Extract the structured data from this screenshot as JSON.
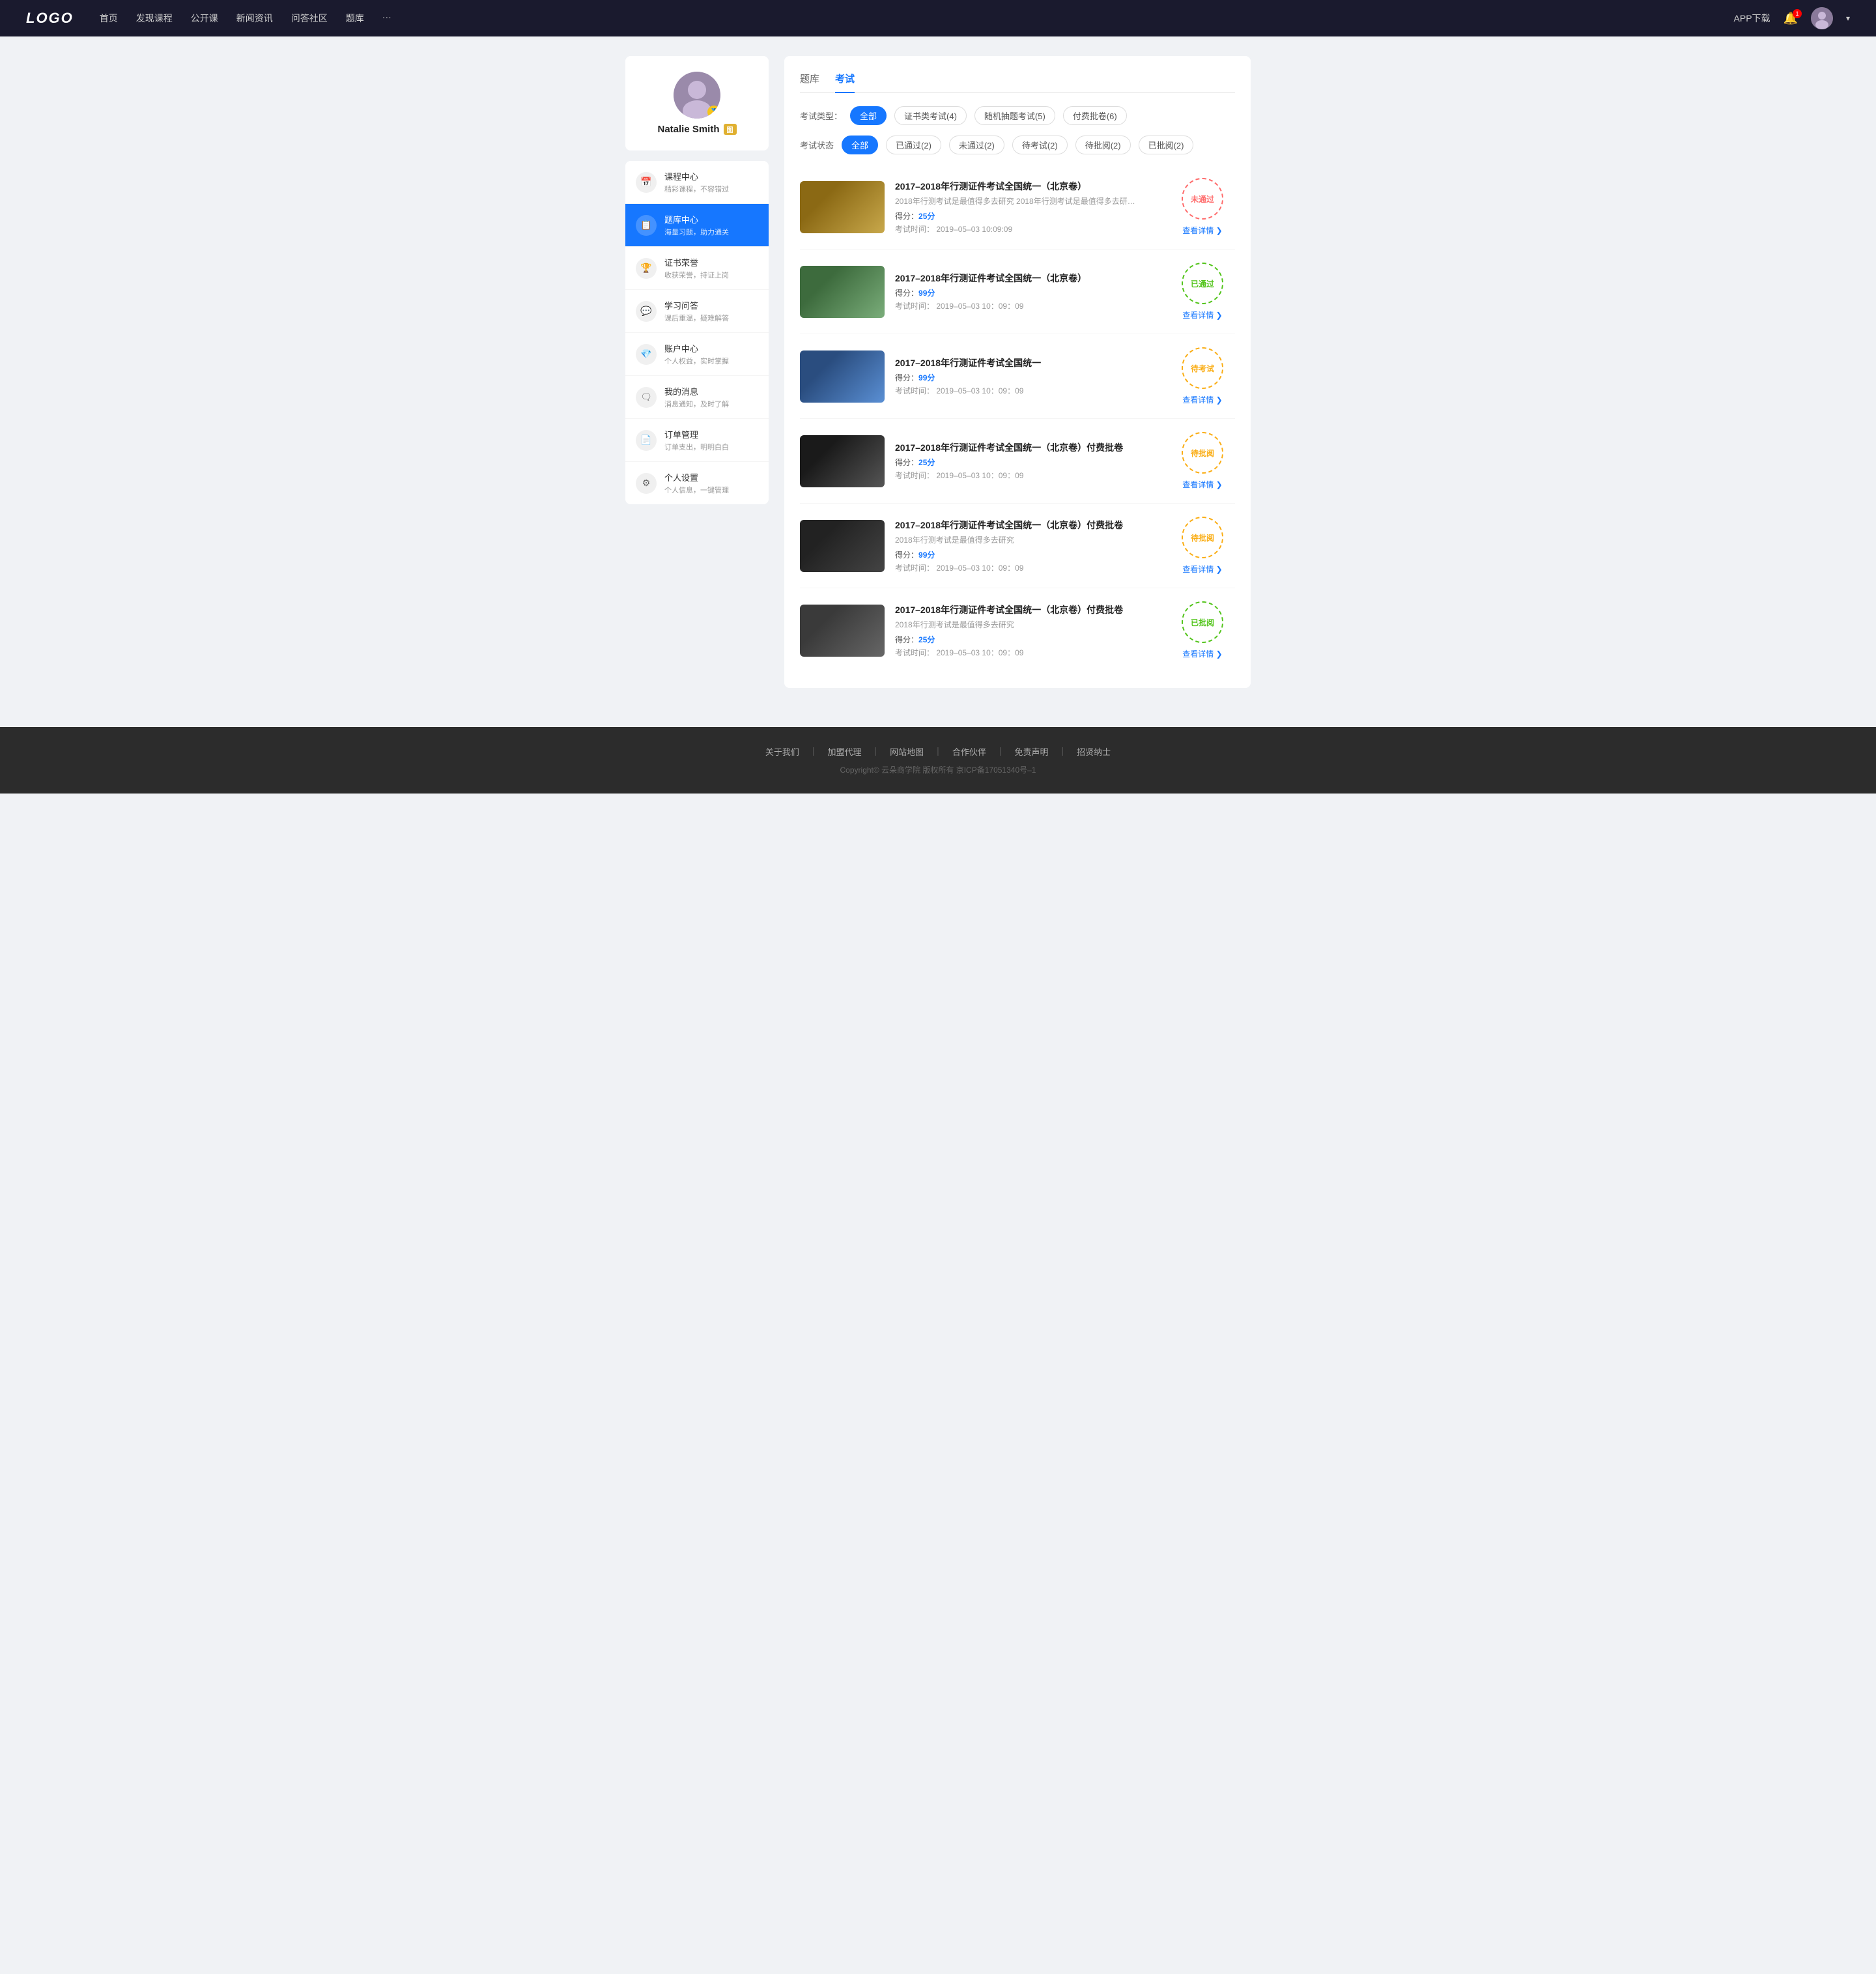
{
  "nav": {
    "logo": "LOGO",
    "links": [
      "首页",
      "发现课程",
      "公开课",
      "新闻资讯",
      "问答社区",
      "题库",
      "···"
    ],
    "app_dl": "APP下载",
    "bell_count": "1"
  },
  "sidebar": {
    "profile": {
      "name": "Natalie Smith",
      "vip_label": "图"
    },
    "menu": [
      {
        "id": "course-center",
        "icon": "📅",
        "title": "课程中心",
        "sub": "精彩课程，不容错过",
        "active": false
      },
      {
        "id": "question-bank",
        "icon": "📋",
        "title": "题库中心",
        "sub": "海量习题，助力通关",
        "active": true
      },
      {
        "id": "certificate",
        "icon": "🏆",
        "title": "证书荣誉",
        "sub": "收获荣誉，持证上岗",
        "active": false
      },
      {
        "id": "qa",
        "icon": "💬",
        "title": "学习问答",
        "sub": "课后重温，疑难解答",
        "active": false
      },
      {
        "id": "account",
        "icon": "💎",
        "title": "账户中心",
        "sub": "个人权益，实时掌握",
        "active": false
      },
      {
        "id": "messages",
        "icon": "🗨",
        "title": "我的消息",
        "sub": "消息通知，及时了解",
        "active": false
      },
      {
        "id": "orders",
        "icon": "📄",
        "title": "订单管理",
        "sub": "订单支出，明明白白",
        "active": false
      },
      {
        "id": "settings",
        "icon": "⚙",
        "title": "个人设置",
        "sub": "个人信息，一键管理",
        "active": false
      }
    ]
  },
  "main": {
    "tabs": [
      {
        "id": "question-bank-tab",
        "label": "题库",
        "active": false
      },
      {
        "id": "exam-tab",
        "label": "考试",
        "active": true
      }
    ],
    "type_filter": {
      "label": "考试类型：",
      "options": [
        {
          "id": "all",
          "label": "全部",
          "active": true
        },
        {
          "id": "cert",
          "label": "证书类考试(4)",
          "active": false
        },
        {
          "id": "random",
          "label": "随机抽题考试(5)",
          "active": false
        },
        {
          "id": "paid",
          "label": "付费批卷(6)",
          "active": false
        }
      ]
    },
    "status_filter": {
      "label": "考试状态",
      "options": [
        {
          "id": "all",
          "label": "全部",
          "active": true
        },
        {
          "id": "passed",
          "label": "已通过(2)",
          "active": false
        },
        {
          "id": "failed",
          "label": "未通过(2)",
          "active": false
        },
        {
          "id": "pending",
          "label": "待考试(2)",
          "active": false
        },
        {
          "id": "wait-review",
          "label": "待批阅(2)",
          "active": false
        },
        {
          "id": "reviewed",
          "label": "已批阅(2)",
          "active": false
        }
      ]
    },
    "exams": [
      {
        "id": "exam-1",
        "thumb_class": "thumb-1",
        "title": "2017–2018年行测证件考试全国统一（北京卷）",
        "desc": "2018年行测考试是最值得多去研究 2018年行测考试是最值得多去研究 2018年行测…",
        "score_label": "得分：",
        "score_value": "25分",
        "time_label": "考试时间：",
        "time_value": "2019–05–03  10:09:09",
        "status": "未通过",
        "stamp_class": "stamp-not-pass",
        "detail_label": "查看详情"
      },
      {
        "id": "exam-2",
        "thumb_class": "thumb-2",
        "title": "2017–2018年行测证件考试全国统一（北京卷）",
        "desc": "",
        "score_label": "得分：",
        "score_value": "99分",
        "time_label": "考试时间：",
        "time_value": "2019–05–03  10：09：09",
        "status": "已通过",
        "stamp_class": "stamp-pass",
        "detail_label": "查看详情"
      },
      {
        "id": "exam-3",
        "thumb_class": "thumb-3",
        "title": "2017–2018年行测证件考试全国统一",
        "desc": "",
        "score_label": "得分：",
        "score_value": "99分",
        "time_label": "考试时间：",
        "time_value": "2019–05–03  10：09：09",
        "status": "待考试",
        "stamp_class": "stamp-pending",
        "detail_label": "查看详情"
      },
      {
        "id": "exam-4",
        "thumb_class": "thumb-4",
        "title": "2017–2018年行测证件考试全国统一（北京卷）付费批卷",
        "desc": "",
        "score_label": "得分：",
        "score_value": "25分",
        "time_label": "考试时间：",
        "time_value": "2019–05–03  10：09：09",
        "status": "待批阅",
        "stamp_class": "stamp-wait-review",
        "detail_label": "查看详情"
      },
      {
        "id": "exam-5",
        "thumb_class": "thumb-5",
        "title": "2017–2018年行测证件考试全国统一（北京卷）付费批卷",
        "desc": "2018年行测考试是最值得多去研究",
        "score_label": "得分：",
        "score_value": "99分",
        "time_label": "考试时间：",
        "time_value": "2019–05–03  10：09：09",
        "status": "待批阅",
        "stamp_class": "stamp-wait-review",
        "detail_label": "查看详情"
      },
      {
        "id": "exam-6",
        "thumb_class": "thumb-6",
        "title": "2017–2018年行测证件考试全国统一（北京卷）付费批卷",
        "desc": "2018年行测考试是最值得多去研究",
        "score_label": "得分：",
        "score_value": "25分",
        "time_label": "考试时间：",
        "time_value": "2019–05–03  10：09：09",
        "status": "已批阅",
        "stamp_class": "stamp-reviewed",
        "detail_label": "查看详情"
      }
    ]
  },
  "footer": {
    "links": [
      "关于我们",
      "加盟代理",
      "网站地图",
      "合作伙伴",
      "免责声明",
      "招贤纳士"
    ],
    "copyright": "Copyright©  云朵商学院   版权所有    京ICP备17051340号–1"
  }
}
